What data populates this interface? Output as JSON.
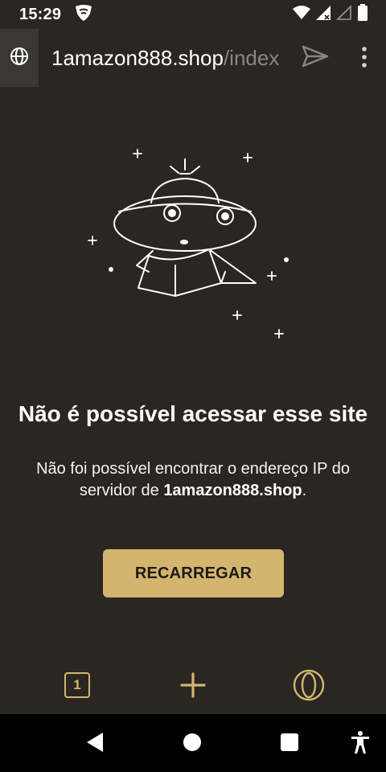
{
  "status_bar": {
    "time": "15:29",
    "icons": [
      "vpn-shield-icon",
      "wifi-icon",
      "signal-icon",
      "signal-empty-icon",
      "battery-icon"
    ]
  },
  "address_bar": {
    "url_domain": "1amazon888.shop",
    "url_path": "/index",
    "icons": [
      "globe-icon",
      "send-icon",
      "more-vert-icon"
    ]
  },
  "error": {
    "title": "Não é possível acessar esse site",
    "description_prefix": "Não foi possível encontrar o endereço IP do servidor de ",
    "description_domain": "1amazon888.shop",
    "description_suffix": ".",
    "reload_label": "RECARREGAR"
  },
  "toolbar": {
    "tab_count": "1",
    "icons": [
      "tabs-icon",
      "plus-icon",
      "opera-icon"
    ]
  },
  "nav_bar": {
    "icons": [
      "back-icon",
      "home-icon",
      "recents-icon",
      "accessibility-icon"
    ]
  },
  "colors": {
    "background": "#2a2722",
    "accent": "#d4b56e",
    "url_path": "#8a8780"
  }
}
